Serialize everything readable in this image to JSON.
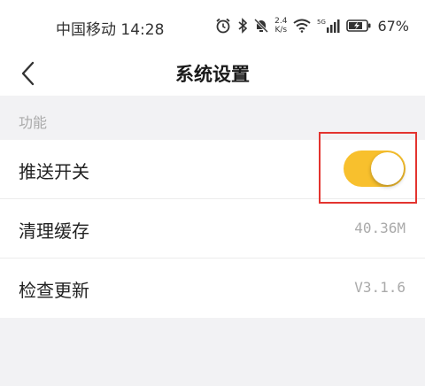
{
  "status_bar": {
    "carrier_time": "中国移动 14:28",
    "net_speed_value": "2.4",
    "net_speed_unit": "K/s",
    "signal_label": "5G",
    "battery_percent": "67%"
  },
  "nav": {
    "title": "系统设置",
    "back_icon": "chevron-left-icon"
  },
  "section": {
    "header": "功能"
  },
  "settings": {
    "push": {
      "label": "推送开关",
      "enabled": true,
      "accent": "#f8c02d"
    },
    "cache": {
      "label": "清理缓存",
      "value": "40.36M"
    },
    "update": {
      "label": "检查更新",
      "value": "V3.1.6"
    }
  },
  "highlight_color": "#e3342f"
}
